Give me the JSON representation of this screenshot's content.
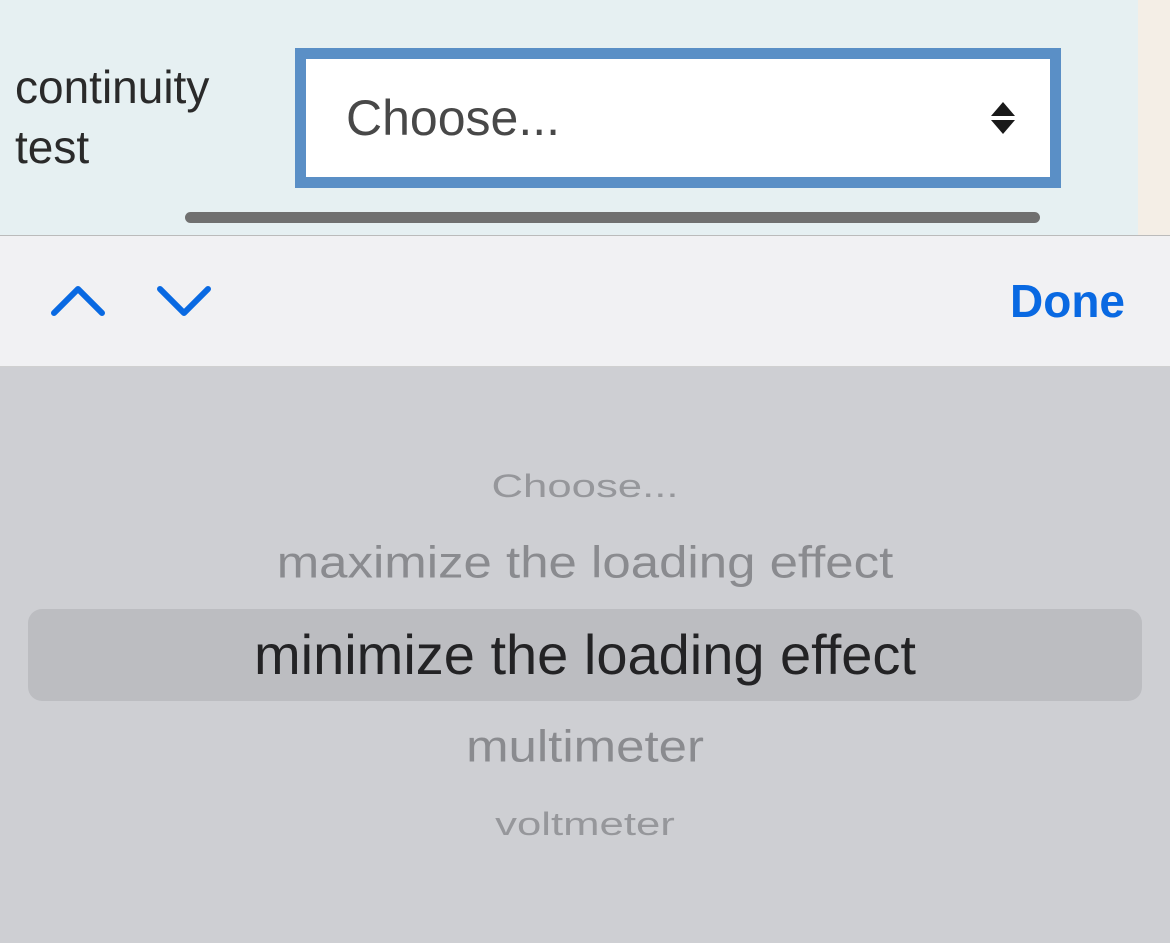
{
  "form": {
    "label": "continuity test",
    "select": {
      "placeholder": "Choose..."
    }
  },
  "toolbar": {
    "done_label": "Done"
  },
  "picker": {
    "options": [
      "Choose...",
      "maximize the loading effect",
      "minimize the loading effect",
      "multimeter",
      "voltmeter"
    ],
    "selected_index": 2
  }
}
